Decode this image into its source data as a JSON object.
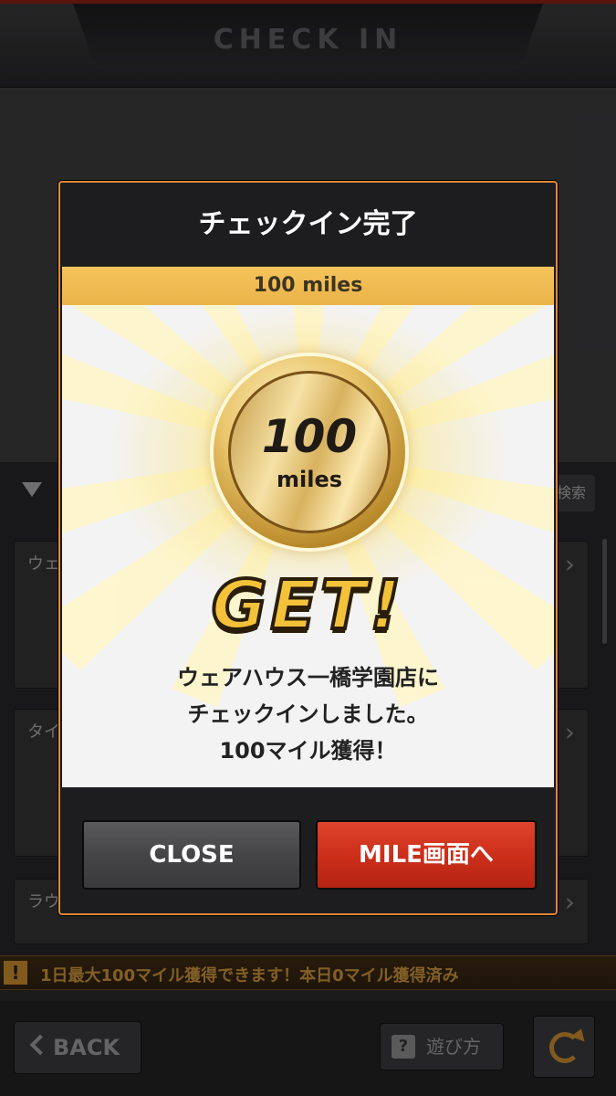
{
  "header": {
    "title": "CHECK IN"
  },
  "background": {
    "search_label": "検索",
    "cards": [
      {
        "label": "ウェ"
      },
      {
        "label": "タイ"
      },
      {
        "label": "ラウ"
      }
    ]
  },
  "notice": {
    "icon": "!",
    "text": "1日最大100マイル獲得できます！本日0マイル獲得済み"
  },
  "bottom": {
    "back_label": "BACK",
    "howto_icon": "?",
    "howto_label": "遊び方"
  },
  "modal": {
    "title": "チェックイン完了",
    "miles_label": "100 miles",
    "coin_value": "100",
    "coin_unit": "miles",
    "get_text": "GET!",
    "message": [
      "ウェアハウス一橋学園店に",
      "チェックインしました。",
      "100マイル獲得！"
    ],
    "close_label": "CLOSE",
    "mile_label": "MILE画面へ"
  },
  "colors": {
    "accent_orange": "#e0883a",
    "primary_red": "#cc2f1b",
    "gold": "#f4c23a",
    "notice_text": "#c8923a"
  }
}
